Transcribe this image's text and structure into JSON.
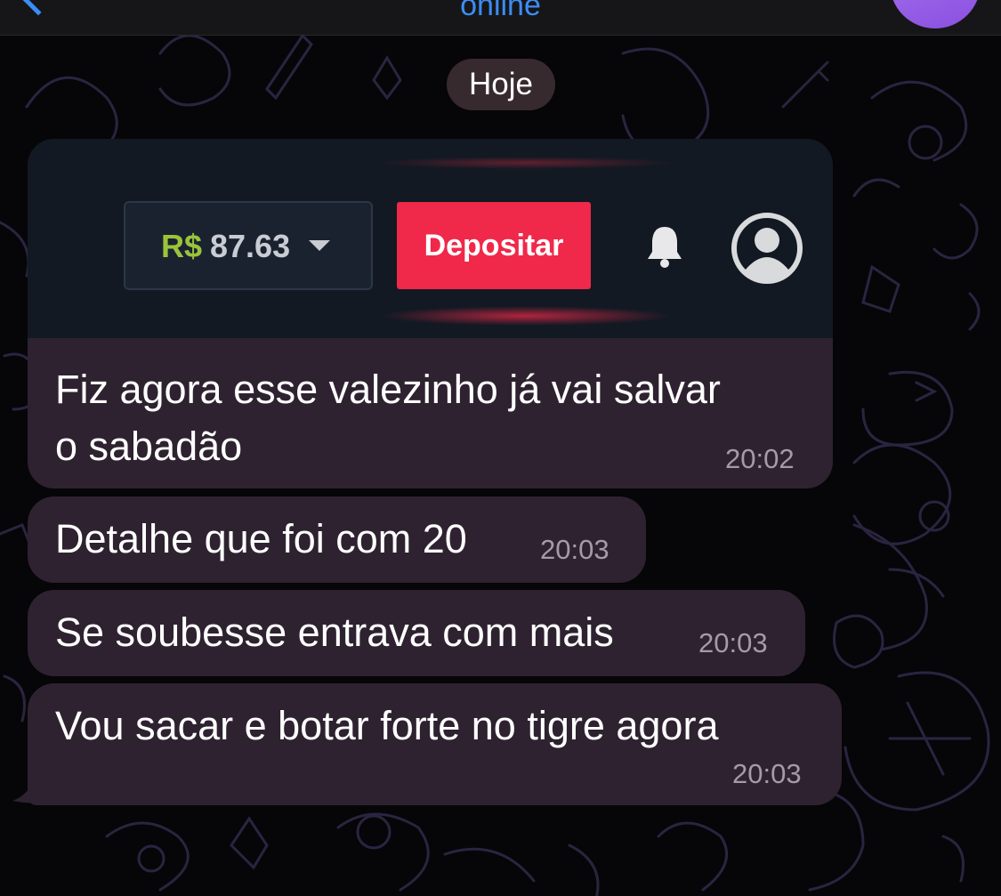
{
  "header": {
    "status": "online"
  },
  "date_separator": "Hoje",
  "photo_message": {
    "screenshot": {
      "currency": "R$",
      "balance": "87.63",
      "deposit_label": "Depositar"
    },
    "caption_line1": "Fiz agora esse valezinho já vai salvar",
    "caption_line2": "o sabadão",
    "time": "20:02"
  },
  "messages": [
    {
      "text": "Detalhe que foi com 20",
      "time": "20:03"
    },
    {
      "text": "Se soubesse entrava com mais",
      "time": "20:03"
    },
    {
      "text": "Vou sacar e botar forte no tigre agora",
      "time": "20:03"
    }
  ],
  "colors": {
    "accent": "#3b8df5",
    "bubble": "#2e2230",
    "deposit": "#f0284a",
    "currency": "#9bc33a"
  },
  "icons": [
    "back-chevron-icon",
    "avatar",
    "bell-icon",
    "profile-icon"
  ]
}
